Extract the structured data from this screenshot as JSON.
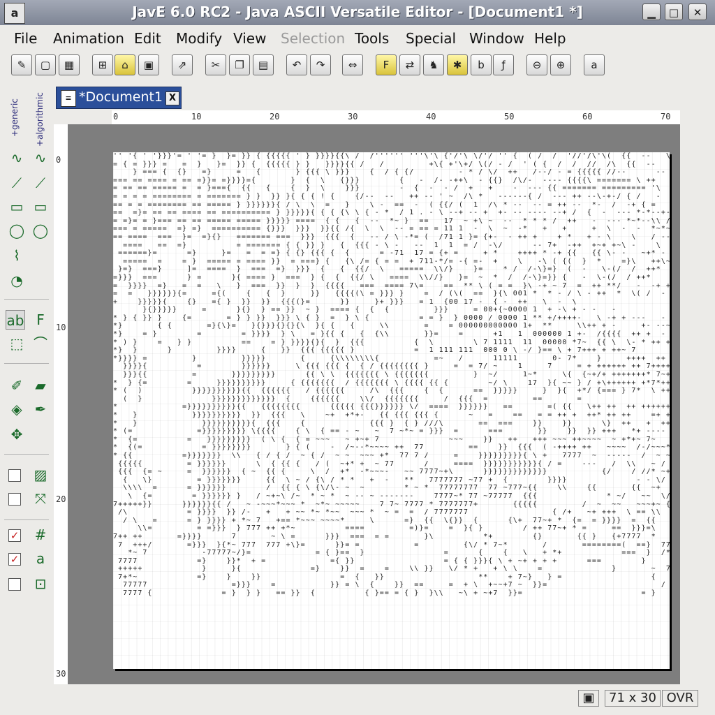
{
  "window": {
    "title": "JavE 6.0 RC2 - Java ASCII Versatile Editor - [Document1 *]",
    "app_icon": "a-icon",
    "controls": {
      "minimize": "▁",
      "maximize": "□",
      "close": "✕"
    }
  },
  "menubar": {
    "items": [
      {
        "label": "File",
        "enabled": true
      },
      {
        "label": "Animation",
        "enabled": true
      },
      {
        "label": "Edit",
        "enabled": true
      },
      {
        "label": "Modify",
        "enabled": true
      },
      {
        "label": "View",
        "enabled": true
      },
      {
        "label": "Selection",
        "enabled": false
      },
      {
        "label": "Tools",
        "enabled": true
      },
      {
        "label": "Special",
        "enabled": true
      },
      {
        "label": "Window",
        "enabled": true
      },
      {
        "label": "Help",
        "enabled": true
      }
    ]
  },
  "toolbar": {
    "icons": [
      "open-wizard-icon",
      "new-document-icon",
      "image-to-ascii-icon",
      "new-folder-icon",
      "open-folder-icon",
      "save-icon",
      "export-icon",
      "cut-icon",
      "copy-icon",
      "paste-icon",
      "undo-icon",
      "redo-icon",
      "resize-canvas-icon",
      "font-icon",
      "convert-icon",
      "camel-icon",
      "plugin-icon",
      "abc-icon",
      "function-icon",
      "zoom-out-icon",
      "zoom-in-icon",
      "about-icon"
    ]
  },
  "sidebar": {
    "generic_label": "+generic",
    "algorithmic_label": "+algorithmic"
  },
  "tab": {
    "label": "*Document1",
    "close_glyph": "X"
  },
  "rulers": {
    "horizontal": [
      "0",
      "10",
      "20",
      "30",
      "40",
      "50",
      "60",
      "70"
    ],
    "vertical": [
      "0",
      "10",
      "20",
      "30"
    ]
  },
  "document": {
    "ascii_lines": [
      "'' '{ ' '}}}'= ' '= }  }= }} { {{{{{ ' } }}}}{{\\ /  /'''''' '''\\'\\ {'/'\\ \\/'/ '' {  ( /  /  '//'/\\'\\(  {{  --   \\   +   {",
      "= { = }}} =   =  }   }=  }} {  {{{{{ } }   }}}}{{ /   /         +\\{ +'\\+/ \\(/ - /  ' ( {  /  /  //  /\\  {{  --    \\   +   \\{",
      "    } === {  {}   =}     =   {       } {{{ \\ }}}    {  / { {/         - * / \\/  ++   /--/ - = {{{{{ //--      --  {\\  /      -+\\   \\    ++ \\   \\/",
      "=== == ==== = == =}}= =}}}}={       }  {  \\   {}}}        {   -  /- -++\\  - {{}  /\\/-  ---- {{{{\\ ======= \\ ++   {           {{  -  ++    //",
      "= == == ===== =  = }==={  {{   {    {  }  \\    }}}        -  {  -  - /  +   +    -  --- {{ ======= ========= '\\  +   {  {  {  +  = ++   /  /",
      "= = = = ======== = ======= } }  }} }{ { { ! {    {/--  --   ++ -- ' ~  /\\ *   ------{ /  --- ++ --\\-+-/ { /   -  +   ( -----  ==  \\  -   /",
      "== = = ======== == ===== } }}}}}}{ / \\  \\  =   }    \\ -  ==  -  ( {{/ (  1  /\\ * --  -- = ++ --  *-  /  -+ { =   {  --  \\ = + /  ---\\(-- = (",
      "==  =}= == == ==== == ========== } }}}}}{ { { {\\ \\ { - *  / 1 . - \\ --+ -- +  +- -- ---- --+ /  {  -  --- *-*--+-{ {  \\ \\   * = ' =-- = -",
      "= =}= = }=== == == ===== ===== }}}}} ====  { {   {  --  *~ }  ==   17  ~ +\\ ~  --  * * * /  ++   -  --- *~*--\\\\ / \\  /   --/  ------ -",
      "=== = =====  =} =}  ========== {}}}  }}}  }}{{ /{  \\  \\  -- = == = 11 1  -  \\  ~  -*   +   +     +  \\  -  -  *~*~//~ / --/  \\",
      "== ====  ===  }=  =}{}   ======= ===  }}}  {{{  {   -- / \\ -*= (  /71 1 }= {+-  - ++ +    + *   + - \\    \\   / --+*~/ \\   \\",
      "  ====   ==  =}          = ======= { { }} }   {  {{{ - \\ -   --  1  1  = /  -\\/      -- 7+  -++  +~+ +~\\ -    \\  \\---    -+-- /  {",
      " ======}=      =}     }=   =  = =} { {} {{{ {  {      = -71  17 = {+ =     + *    ++++ * -+ {{   {{ \\- -   ~+* -   \\",
      "  =====  =    = }  ===== = ==== }}  = ===} {   {\\ /= { = =  + 711-*/= -{ =-  +    \\   -\\ ( {(  }  *    =}\\   ++\\~ - ~\\   \\",
      " }=}  ===}     ]=  ====  }  ===  =}  }}}  {   {  {{/  \\   =====  \\\\/}    }=    * /  /-\\}=}  (  -   \\-(/  /  ++*  ** ----+  {  /  /\\  \\\\",
      "=}}}  ===      } =      }{ ==== }  ===  } {  {  {{/ \\   ====  \\\\//}   }=  ~  *  /  /-\\}=}} {   -  \\-(/  / ++*    ** ----+ { / / \\  \\\\",
      "=  }}}}  =}   =  =   \\   }  ===  }}  }  }  {{{{   ===  ==== 7\\=    ==  ** \\ ( = =  }\\ -+ ~ 7  =  ++ **/   -  -+ +  (   /  -\\",
      "=  =   }}}}}}{=     ={(    {   {  }     }}   {{{{(\\ = }}} }    =  / (\\(  ==  }{\\ 001 *  * - / \\ - ++  *  \\( /  - \\ -",
      "+    }}}}}{    {}   ={ }  }}  }}  {{{(}=      }}     }+ }}}   = 1  {00 17 -  { -  ++   \\  -  \\",
      "      }{}}}}}     =      }{}  } == }}  ~ }  ==== {  {  {         }}}     = 00+{~0000 1  + -\\ + - -   -",
      "* } { }} }    {=       = } } }}  }}} \\ { }  =  } \\ {          = = }  } 0000 / 0000 1 ** +/++++-   \\ -+ + ---   -",
      "*}       { {       =}{\\}=   }{}}}{}{}{\\  }{ {   {     \\\\       =    = 000000000000 1+  **     \\\\++ + -     +- --~",
      "*}    = }        =        = }}}}  } \\   = }{{ {   {  {\\\\       }}=    =      +1   1  000000 1 +-  /{{{{  ++ +  -   + - -~*",
      "* ) }    =   } }          ==    = } }}}}{}{  }  {{{          {  \\        \\ 7 1111  11  00000 *7~  {{ \\  \\- * ++ + + --*",
      "*}  }      }         }}}}     {   }}  {{{ {{{{{ }            =  1 111 111  000 0 \\ -/ }== \\ + 7+++ + ++~ 7",
      "*}}}} =         }         }}}}}       {     {\\\\\\\\\\\\\\\\{           =~   /      11111       0- 7*    }     ++++  ++ 7*+  //",
      "  }}}}{          =        }}}}}}     \\ {{{ {{{ {  { / {{{{{{{{ }     =  = 7/ ~    1     7     = + ++++++ ++ 7+++++//",
      "  }}}{{         =       }}}}}}}}}      {{ \\ \\  {{{{{{{ \\ {{{{{{{         }  ~/     1~*     \\{  {~+/+ +++++++* 7~++++++//",
      "*  } {=        =     }}}}}}}}}}     { {{{{{{{  / {{{{{{{ \\ {{{{ {{ {        ~/ \\    17  }{ ~~ } / +\\++++++ +*7*++++++//",
      "* (  )          }}}}}}}}}}{{  {{{{{{   / {{{{{{     /\\  {{{    {  {      ==  }}}}}     }  }{  +*/ {=== } 7*  \\ ++++++++ + ++++++++-",
      "  (  }              }}}}}}}}}}}}}  {    {{{{{{    \\\\/  {{{{{{{     /  {{{  =         ==       =                  {+/   \\++++++++ +++++++-  +~",
      "*             =}}}}}}}}}}{{   {{{{{{{{      {{{{{ {{{}}}}}} \\/  ====  }}}}}}   ==       =( {{   \\++ ++  ++ ++++++++   +/-",
      "*   }           }}}}}}}}}}  }}  {{{   \\    ~+  +*+-   {{ {{{ {{{ {      ~   =    ==   = = ++ +  ++* ++ ++    =+ ++  +~",
      "*   }             }}}}}}}}}}{  {{{    {             {{{ }  { } ///\\       ==  ===    }}    }}      \\}  ++   +  ++ ++   + +",
      "* (=             =}}}}}}}}} \\{{{{    { \\  { == - ~   ~  7 ~*~ = }}}  =      ===       }}    }}  }} +++   *+ ----   +~~~+ *77",
      "*  {=          =   }}}}}}}}}  ( \\ {  { = ~~~   ~ +~+ 7              ~~~    }}   ++   +++ ~~~ ++~~~~  ~ +*+~ 7~",
      "*  {(=            = }}}}}}}}       } { (    -  /~--*~~~~ ++  77         ==    }}  {{{  ( -++++ ++   ~~~~  /-/~~~* +  )*7 /",
      "* {{          =}}}}}}}  \\\\   { / { /  ~ { /  ~ ~  ~~~ +*  77 7 /     =    }}}}}}}}}{ \\ +   7777  ~  -----  /  ~ ~~  * -    ~/+",
      " {{{{{         = }}}}}}      \\  { {{ {   / (  ~+* +  ~ 77      /     ====  }}}}}}}}}}}{ / =    ---   /  \\\\   ~ / = //  *~~*+*{{  {\\{ ~+ +",
      " {{{  {= ~     =  }}}}}}  { ~  {{ {     \\  /  +*  -*~~~-   ~~ 7777~+\\      }}}}}}}}}}}}}           {/    / //* ~+ * / (  { }*7+ +",
      "  {   \\}         = }}}}}}}     {{  \\ ~ / {\\ / * *   +  -   **   7777777 ~77 +  {        }}}}              - - \\/ - + ~ + }   * -",
      "  \\\\\\\\  =      = }}}}}}        /  {{ { \\ {\\/\\- ~  ~        * ~ *  77777777  77 ~777~{{    \\\\    {{       {{  ~+   \\  \\ ~~ *   /\\  {  } *  ~ -",
      "   \\  {=        = }}}}}} }   / ~+~\\ /~  * ~ *  ~ -- ~ -------    7777~* 77 ~77777  {{{              * ~/   ~~  \\/  +*  7~  ~ +~*+",
      "7+++++}}      }}}}}}{{ /   ~ -~~~*~~~ *  ~*~ ~~~~~    7 7~ 7777 * 7777777+       {{{{{         /  ~  ~~   ~~~+~ {     7777777777 +~~/ * +++",
      " /\\            = }}}}  }} /-   +   + ~~ *~ *~~  ~~~ *  ~ =  =  / 7777777                 { /+   ~+ +++  \\ == \\\\  {     77777777+*  ~ + + +-",
      "  / \\   =      = } }}}} + *~ 7   +== *~~~ ~~~~*     \\      =}  {{  \\{}}  {      {\\+  77~+ *  {=  = }}}}  =  {{   7777777 + *+~ ~ ~+/",
      "     \\\\=         = =}}}  } 777 ++ +*~          ====         =)}=    =  }{ }        / ++ 77~+ * =     ==  }}}=\\     777777 +~~ ~  \\\\",
      "7++ ++       =}}}}      7       ~ \\ =      }}}  ===  = =       }\\          *+        {}       {{ }   {+7777  *      ~+ ~",
      " 7  +++/       =}}}  }{*~ 777  777 +\\}=      }}= =           =         {\\/ * 7~*       /       ========(  ==}  77 + *     +",
      "   *~ 7           -77777~/}=             = { }==  }                =      {    {   \\   + *+            ===  }  /*  7~~   *  ~",
      " 7777            =}    }}*  + =             ={ }}                  = { { }}}{ \\ + ~+ + + +      ===        }      7*    +*  ~/",
      " +++++            }     }{              =}    }}  =    =    \\\\ }}   \\/ * +   + \\ \\    =              }       ~  7    +~  //",
      " 7+*~            =}    }    }}                =  {   }}                   **    + 7~}   } =                  {   77 +  ~//",
      "  77777                 =}}}    =           }} = \\  {    }}  ==     =  + \\  +~~+7 ~  }}=                       / 7* 7 ~//",
      "  7777 {              = }  } }   == }}  {          { }== = { }  }\\\\   ~\\ + ~+7  }}=                        = }       {  \\   7~~//"
    ]
  },
  "statusbar": {
    "icon": "document-size-icon",
    "size": "71 x 30",
    "mode": "OVR"
  }
}
